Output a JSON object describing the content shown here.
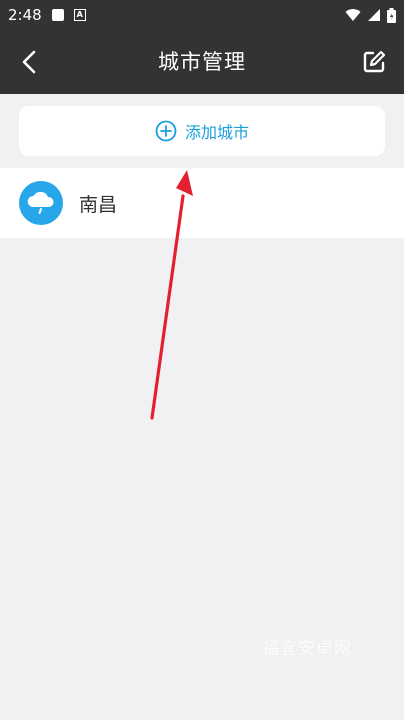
{
  "status_bar": {
    "time": "2:48",
    "icons": [
      "square-icon",
      "a-badge-icon",
      "wifi-icon",
      "signal-icon",
      "battery-icon"
    ],
    "badge_letter": "A"
  },
  "header": {
    "title": "城市管理",
    "back_icon": "chevron-left-icon",
    "edit_icon": "edit-icon"
  },
  "add_city": {
    "label": "添加城市",
    "icon": "plus-circle-icon"
  },
  "cities": [
    {
      "name": "南昌",
      "icon": "cloud-rain-icon"
    }
  ],
  "watermark": "福宜安卓网",
  "colors": {
    "header_bg": "#333333",
    "page_bg": "#f1f1f3",
    "accent": "#1a9fdc",
    "weather_icon_bg": "#27a7ea",
    "arrow": "#e5202e"
  }
}
